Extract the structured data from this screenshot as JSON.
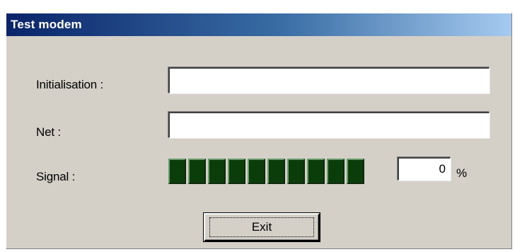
{
  "window": {
    "title": "Test modem"
  },
  "form": {
    "init_label": "Initialisation :",
    "init_value": "",
    "net_label": "Net :",
    "net_value": "",
    "signal_label": "Signal :",
    "signal_level": 0,
    "signal_segments": 10,
    "signal_percent": "0",
    "percent_symbol": "%"
  },
  "buttons": {
    "exit_label": "Exit"
  },
  "colors": {
    "title_gradient_start": "#0a246a",
    "title_gradient_end": "#a6caf0",
    "dialog_background": "#d4d0c8",
    "signal_off": "#0a3d0a",
    "signal_on": "#1fd11f"
  }
}
